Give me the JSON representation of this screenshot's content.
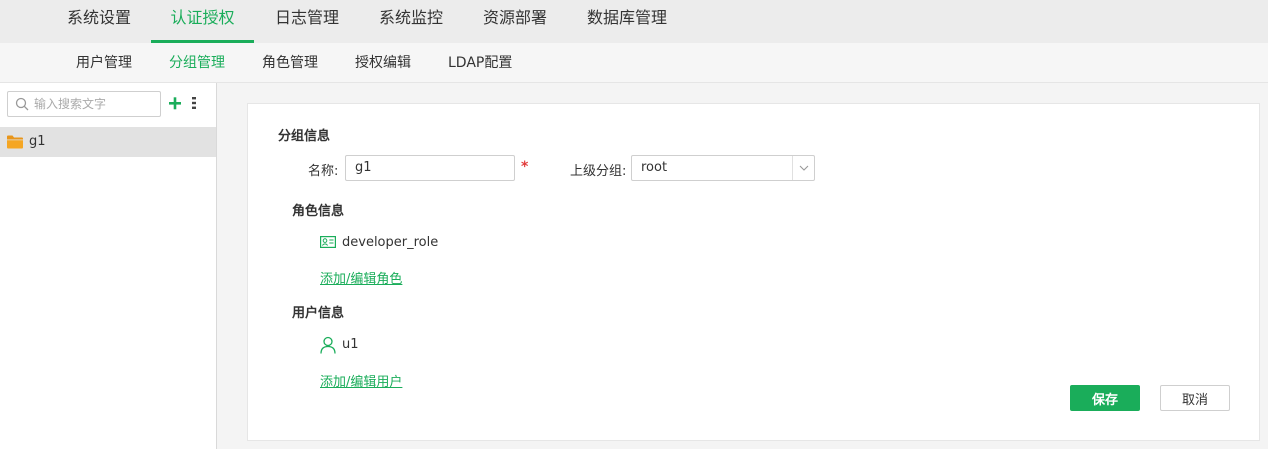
{
  "topnav": {
    "tabs": [
      {
        "label": "系统设置"
      },
      {
        "label": "认证授权"
      },
      {
        "label": "日志管理"
      },
      {
        "label": "系统监控"
      },
      {
        "label": "资源部署"
      },
      {
        "label": "数据库管理"
      }
    ],
    "active_index": 1
  },
  "subnav": {
    "tabs": [
      {
        "label": "用户管理"
      },
      {
        "label": "分组管理"
      },
      {
        "label": "角色管理"
      },
      {
        "label": "授权编辑"
      },
      {
        "label": "LDAP配置"
      }
    ],
    "active_index": 1
  },
  "sidebar": {
    "search_placeholder": "输入搜索文字",
    "add_icon": "plus-icon",
    "menu_icon": "vertical-menu-icon",
    "items": [
      {
        "label": "g1",
        "icon": "folder-icon"
      }
    ]
  },
  "form": {
    "section_title": "分组信息",
    "name_label": "名称:",
    "name_value": "g1",
    "required_mark": "*",
    "parent_label": "上级分组:",
    "parent_value": "root",
    "role_section_title": "角色信息",
    "roles": [
      {
        "label": "developer_role",
        "icon": "role-card-icon"
      }
    ],
    "add_role_link": "添加/编辑角色",
    "user_section_title": "用户信息",
    "users": [
      {
        "label": "u1",
        "icon": "user-icon"
      }
    ],
    "add_user_link": "添加/编辑用户",
    "save_label": "保存",
    "cancel_label": "取消"
  },
  "colors": {
    "accent": "#1aad5a",
    "topnav_bg": "#ececec",
    "subnav_bg": "#f6f6f6",
    "folder": "#f5a623",
    "required": "#e23b3b"
  }
}
